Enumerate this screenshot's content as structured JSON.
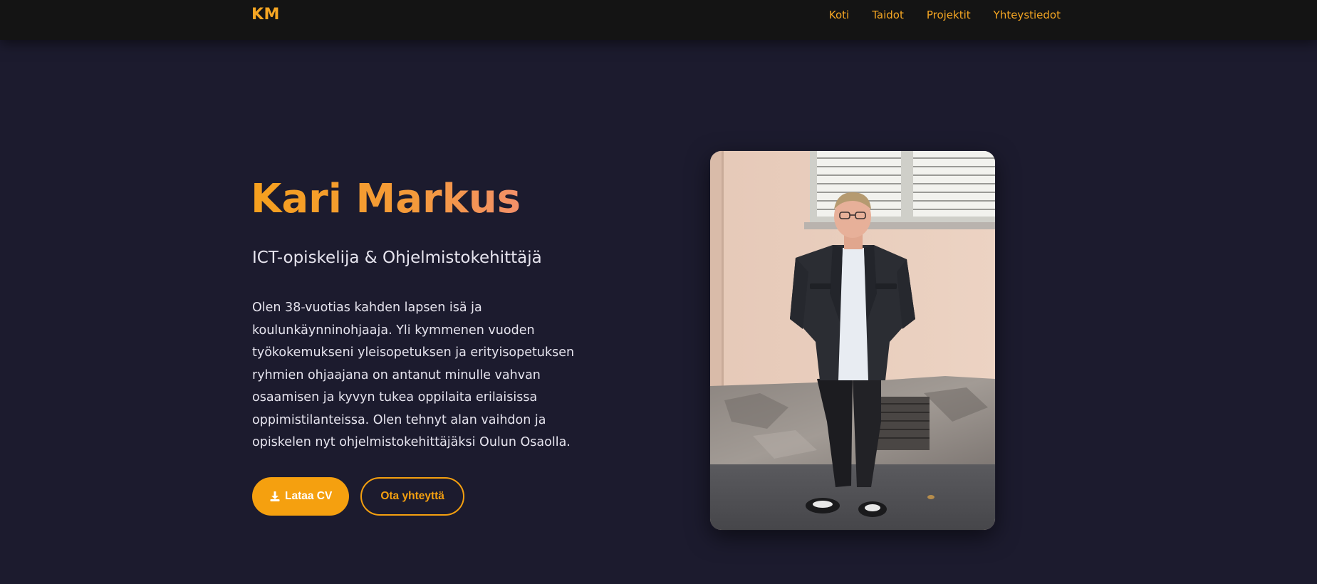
{
  "nav": {
    "logo": "KM",
    "links": [
      {
        "label": "Koti"
      },
      {
        "label": "Taidot"
      },
      {
        "label": "Projektit"
      },
      {
        "label": "Yhteystiedot"
      }
    ]
  },
  "hero": {
    "name": "Kari Markus",
    "tagline": "ICT-opiskelija & Ohjelmistokehittäjä",
    "bio": "Olen 38-vuotias kahden lapsen isä ja koulunkäynninohjaaja. Yli kymmenen vuoden työkokemukseni yleisopetuksen ja erityisopetuksen ryhmien ohjaajana on antanut minulle vahvan osaamisen ja kyvyn tukea oppilaita erilaisissa oppimistilanteissa. Olen tehnyt alan vaihdon ja opiskelen nyt ohjelmistokehittäjäksi Oulun Osaolla.",
    "buttons": {
      "download_cv": "Lataa CV",
      "contact": "Ota yhteyttä"
    },
    "icons": {
      "download": "download-icon"
    }
  },
  "colors": {
    "accent": "#f5a00f",
    "background": "#1c1b2e",
    "navbar": "#141414",
    "text": "#e6e4ee"
  }
}
